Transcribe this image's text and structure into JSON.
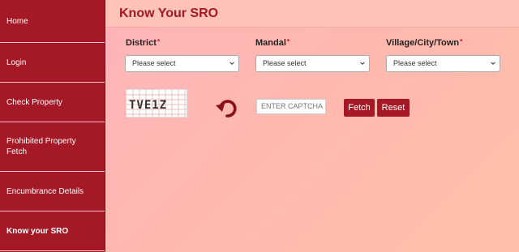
{
  "sidebar": {
    "items": [
      {
        "label": "Home"
      },
      {
        "label": "Login"
      },
      {
        "label": "Check Property"
      },
      {
        "label": "Prohibited Property Fetch"
      },
      {
        "label": "Encumbrance Details"
      },
      {
        "label": "Know your SRO"
      }
    ]
  },
  "page": {
    "title": "Know Your SRO"
  },
  "form": {
    "district": {
      "label": "District",
      "required_mark": "*",
      "value": "Please select"
    },
    "mandal": {
      "label": "Mandal",
      "required_mark": "*",
      "value": "Please select"
    },
    "village": {
      "label": "Village/City/Town",
      "required_mark": "*",
      "value": "Please select"
    },
    "captcha": {
      "text": "TVE1Z",
      "placeholder": "ENTER CAPTCHA"
    },
    "fetch_label": "Fetch",
    "reset_label": "Reset"
  },
  "colors": {
    "accent": "#a51826"
  }
}
